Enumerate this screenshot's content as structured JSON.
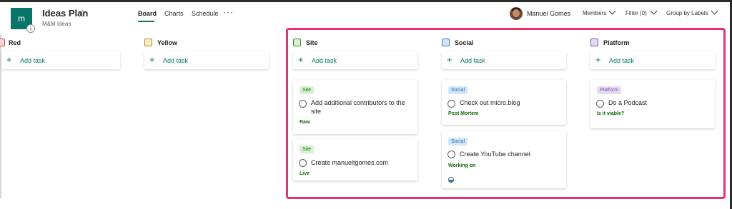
{
  "header": {
    "app_tile_letter": "m",
    "plan_title": "Ideas Plan",
    "group_name": "M&M Ideas",
    "tabs": [
      "Board",
      "Charts",
      "Schedule"
    ],
    "more_icon": "ellipsis-icon",
    "user_name": "Manuel Gomes",
    "members_label": "Members",
    "filter_label": "Filter (0)",
    "group_by_label": "Group by Labels"
  },
  "board": {
    "add_task_label": "Add task",
    "columns": [
      {
        "title": "Red",
        "swatch_bg": "#f6d5d2",
        "swatch_border": "#c4524c"
      },
      {
        "title": "Yellow",
        "swatch_bg": "#f7ecc4",
        "swatch_border": "#b08a2e"
      },
      {
        "title": "Site",
        "swatch_bg": "#d6f0d0",
        "swatch_border": "#3a8a3a"
      },
      {
        "title": "Social",
        "swatch_bg": "#d4e7f8",
        "swatch_border": "#3c7cc2"
      },
      {
        "title": "Platform",
        "swatch_bg": "#e6dcf0",
        "swatch_border": "#7a4fa8"
      }
    ],
    "cards": {
      "site_1": {
        "tag": "Site",
        "title": "Add additional contributors to the site",
        "bucket": "Raw"
      },
      "site_2": {
        "tag": "Site",
        "title": "Create manueltgomes.com",
        "bucket": "Live"
      },
      "social_1": {
        "tag": "Social",
        "title": "Check out micro.blog",
        "bucket": "Post Mortem"
      },
      "social_2": {
        "tag": "Social",
        "title": "Create YouTube channel",
        "bucket": "Working on",
        "progress": 0.5
      },
      "platform_1": {
        "tag": "Platform",
        "title": "Do a Podcast",
        "bucket": "Is it viable?"
      }
    }
  },
  "colors": {
    "accent": "#077568",
    "highlight": "#e8336a"
  }
}
